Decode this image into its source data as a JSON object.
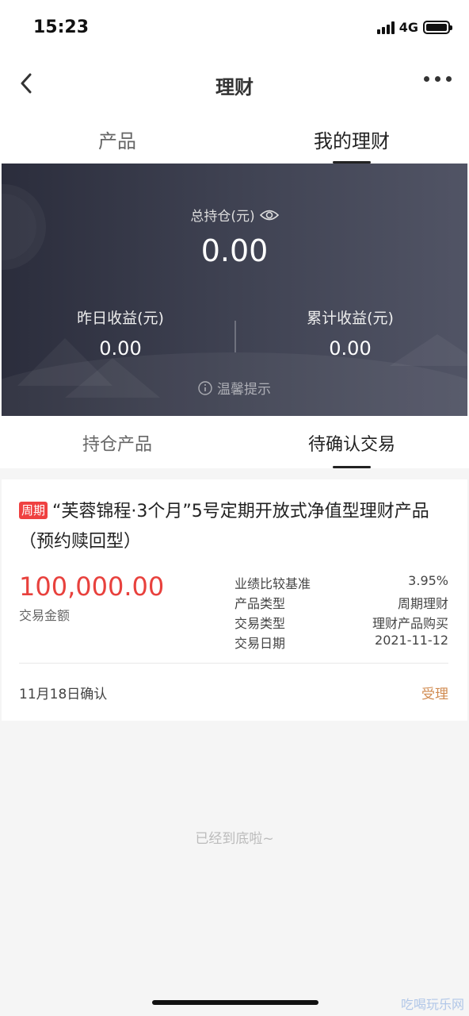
{
  "status_bar": {
    "time": "15:23",
    "network": "4G"
  },
  "nav": {
    "back_icon": "chevron-left-icon",
    "title": "理财",
    "more_icon": "more-dots-icon"
  },
  "top_tabs": [
    {
      "label": "产品",
      "active": false
    },
    {
      "label": "我的理财",
      "active": true
    }
  ],
  "summary": {
    "total_label": "总持仓(元)",
    "total_value": "0.00",
    "yesterday_label": "昨日收益(元)",
    "yesterday_value": "0.00",
    "cumulative_label": "累计收益(元)",
    "cumulative_value": "0.00",
    "tip": "温馨提示"
  },
  "sub_tabs": [
    {
      "label": "持仓产品",
      "active": false
    },
    {
      "label": "待确认交易",
      "active": true
    }
  ],
  "transaction": {
    "tag": "周期",
    "title": "“芙蓉锦程·3个月”5号定期开放式净值型理财产品（预约赎回型）",
    "amount": "100,000.00",
    "amount_label": "交易金额",
    "details": [
      {
        "key": "业绩比较基准",
        "value": "3.95%"
      },
      {
        "key": "产品类型",
        "value": "周期理财"
      },
      {
        "key": "交易类型",
        "value": "理财产品购买"
      },
      {
        "key": "交易日期",
        "value": "2021-11-12"
      }
    ],
    "confirm_date": "11月18日确认",
    "status": "受理"
  },
  "end_text": "已经到底啦~",
  "watermark": "吃喝玩乐网",
  "colors": {
    "accent_red": "#e8413d",
    "tag_red": "#ef4141",
    "status_orange": "#d08a4f",
    "hero_dark": "#2b2d3c"
  }
}
